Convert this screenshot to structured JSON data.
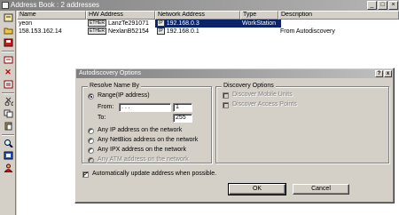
{
  "window": {
    "title": "Address Book : 2 addresses"
  },
  "toolbar": {
    "icons": [
      "address-book-icon",
      "open-folder-icon",
      "save-icon",
      "new-entry-icon",
      "delete-icon",
      "properties-icon",
      "cut-icon",
      "copy-icon",
      "paste-icon",
      "find-icon",
      "import-icon",
      "user-icon"
    ]
  },
  "list": {
    "columns": [
      "Name",
      "HW Address",
      "Network Address",
      "Type",
      "Description"
    ],
    "rows": [
      {
        "name": "yeon",
        "hw_badge": "ETHER",
        "hw": "LanzTe291071",
        "net_badge": "IP",
        "net": "192.168.0.3",
        "type": "WorkStation",
        "desc": ""
      },
      {
        "name": "158.153.162.14",
        "hw_badge": "ETHER",
        "hw": "NexlanB52154",
        "net_badge": "IP",
        "net": "192.168.0.1",
        "type": "",
        "desc": "From Autodiscovery"
      }
    ]
  },
  "dialog": {
    "title": "Autodiscovery Options",
    "help_label": "?",
    "close_label": "x",
    "resolve_group": "Resolve Name By",
    "range_label": "Range(IP address)",
    "from_label": "From:",
    "from_value": " .   .   . ",
    "from_last": "1",
    "to_label": "To:",
    "to_value": "255",
    "any_ip": "Any IP address on the network",
    "any_netbios": "Any NetBios address on the network",
    "any_ipx": "Any IPX address on the network",
    "any_atm": "Any ATM address on the network",
    "discovery_group": "Discovery Options",
    "discover_mobile": "Discover Mobile Units",
    "discover_ap": "Discover Access Points",
    "auto_update": "Automatically update address when possible.",
    "auto_update_checked": true,
    "ok_label": "OK",
    "cancel_label": "Cancel"
  }
}
